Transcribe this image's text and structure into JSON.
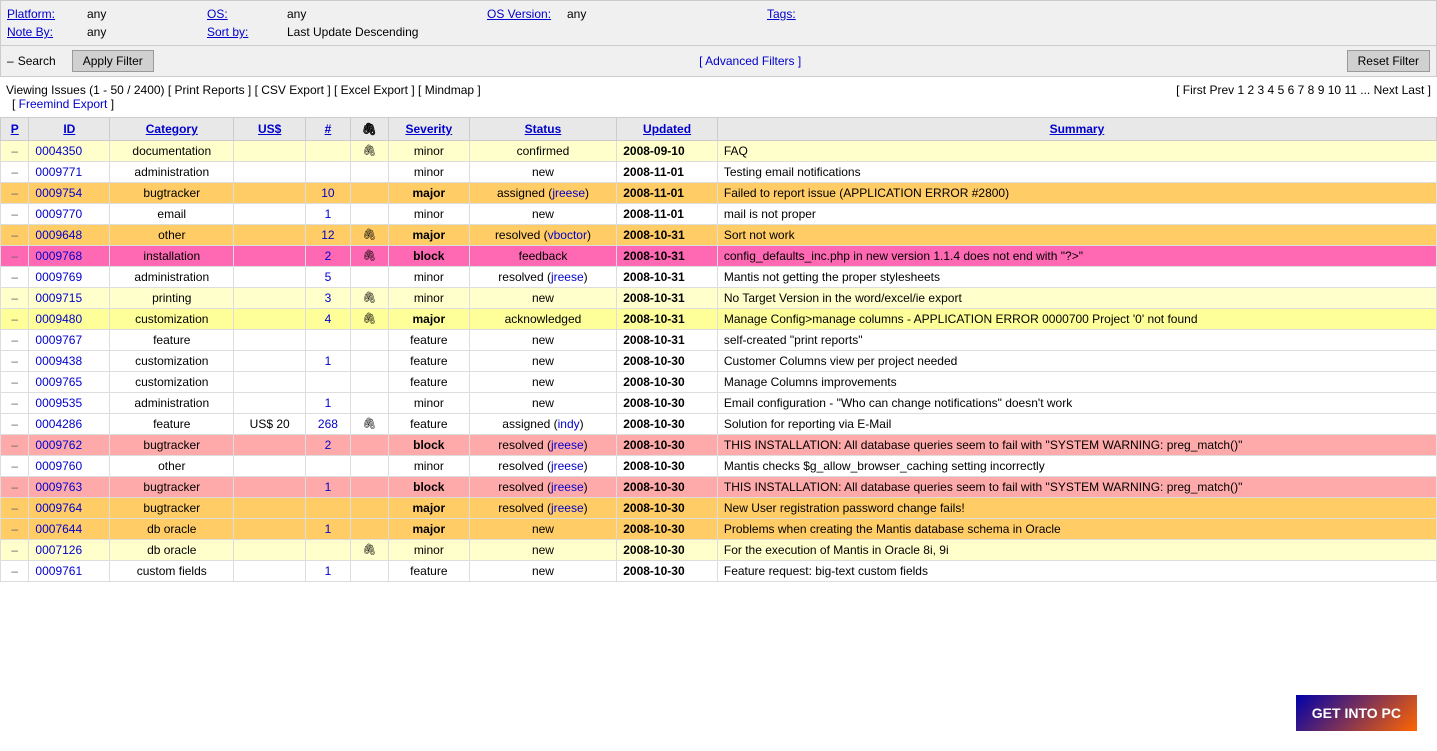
{
  "filter": {
    "labels": {
      "platform": "Platform:",
      "os": "OS:",
      "os_version": "OS Version:",
      "tags": "Tags:",
      "note_by": "Note By:",
      "sort_by": "Sort by:"
    },
    "values": {
      "platform": "any",
      "os": "any",
      "os_version": "any",
      "tags": "",
      "note_by": "any",
      "sort_by": "Last Update Descending"
    }
  },
  "search": {
    "label": "Search",
    "apply_label": "Apply Filter",
    "reset_label": "Reset Filter",
    "advanced_label": "[ Advanced Filters ]"
  },
  "issues": {
    "title": "Viewing Issues (1 - 50 / 2400)",
    "links": {
      "print": "Print Reports",
      "csv": "CSV Export",
      "excel": "Excel Export",
      "mindmap": "Mindmap",
      "freemind": "Freemind Export"
    },
    "pagination": {
      "text": "[ First Prev 1 2 3 4 5 6 7 8 9 10 11 ... Next Last ]",
      "first": "First",
      "prev": "Prev",
      "pages": [
        "1",
        "2",
        "3",
        "4",
        "5",
        "6",
        "7",
        "8",
        "9",
        "10",
        "11"
      ],
      "next": "Next",
      "last": "Last"
    }
  },
  "columns": {
    "p": "P",
    "id": "ID",
    "category": "Category",
    "us": "US$",
    "hash": "#",
    "clip": "🖇",
    "severity": "Severity",
    "status": "Status",
    "updated": "Updated",
    "summary": "Summary"
  },
  "rows": [
    {
      "rowClass": "row-light",
      "dash": "–",
      "id": "0004350",
      "category": "documentation",
      "us": "",
      "hash": "",
      "clip": "🖇",
      "severity": "minor",
      "severityBold": false,
      "status": "confirmed",
      "statusLink": true,
      "statusLinked": "",
      "updated": "2008-09-10",
      "summary": "FAQ"
    },
    {
      "rowClass": "row-white",
      "dash": "–",
      "id": "0009771",
      "category": "administration",
      "us": "",
      "hash": "",
      "clip": "",
      "severity": "minor",
      "severityBold": false,
      "status": "new",
      "statusLink": false,
      "statusLinked": "",
      "updated": "2008-11-01",
      "summary": "Testing email notifications"
    },
    {
      "rowClass": "row-orange",
      "dash": "–",
      "id": "0009754",
      "category": "bugtracker",
      "us": "",
      "hash": "10",
      "clip": "",
      "severity": "major",
      "severityBold": true,
      "status": "assigned",
      "statusLink": true,
      "statusLinked": "jreese",
      "updated": "2008-11-01",
      "summary": "Failed to report issue (APPLICATION ERROR #2800)"
    },
    {
      "rowClass": "row-white",
      "dash": "–",
      "id": "0009770",
      "category": "email",
      "us": "",
      "hash": "1",
      "clip": "",
      "severity": "minor",
      "severityBold": false,
      "status": "new",
      "statusLink": false,
      "statusLinked": "",
      "updated": "2008-11-01",
      "summary": "mail is not proper"
    },
    {
      "rowClass": "row-orange",
      "dash": "–",
      "id": "0009648",
      "category": "other",
      "us": "",
      "hash": "12",
      "clip": "🖇",
      "severity": "major",
      "severityBold": true,
      "status": "resolved",
      "statusLink": true,
      "statusLinked": "vboctor",
      "updated": "2008-10-31",
      "summary": "Sort not work"
    },
    {
      "rowClass": "row-hotpink",
      "dash": "–",
      "id": "0009768",
      "category": "installation",
      "us": "",
      "hash": "2",
      "clip": "🖇",
      "severity": "block",
      "severityBold": true,
      "status": "feedback",
      "statusLink": false,
      "statusLinked": "",
      "updated": "2008-10-31",
      "summary": "config_defaults_inc.php in new version 1.1.4 does not end with \"?>\""
    },
    {
      "rowClass": "row-white",
      "dash": "–",
      "id": "0009769",
      "category": "administration",
      "us": "",
      "hash": "5",
      "clip": "",
      "severity": "minor",
      "severityBold": false,
      "status": "resolved",
      "statusLink": true,
      "statusLinked": "jreese",
      "updated": "2008-10-31",
      "summary": "Mantis not getting the proper stylesheets"
    },
    {
      "rowClass": "row-light",
      "dash": "–",
      "id": "0009715",
      "category": "printing",
      "us": "",
      "hash": "3",
      "clip": "🖇",
      "severity": "minor",
      "severityBold": false,
      "status": "new",
      "statusLink": false,
      "statusLinked": "",
      "updated": "2008-10-31",
      "summary": "No Target Version in the word/excel/ie export"
    },
    {
      "rowClass": "row-yellow",
      "dash": "–",
      "id": "0009480",
      "category": "customization",
      "us": "",
      "hash": "4",
      "clip": "🖇",
      "severity": "major",
      "severityBold": true,
      "status": "acknowledged",
      "statusLink": false,
      "statusLinked": "",
      "updated": "2008-10-31",
      "summary": "Manage Config>manage columns - APPLICATION ERROR 0000700 Project '0' not found"
    },
    {
      "rowClass": "row-white",
      "dash": "–",
      "id": "0009767",
      "category": "feature",
      "us": "",
      "hash": "",
      "clip": "",
      "severity": "feature",
      "severityBold": false,
      "status": "new",
      "statusLink": false,
      "statusLinked": "",
      "updated": "2008-10-31",
      "summary": "self-created \"print reports\""
    },
    {
      "rowClass": "row-white",
      "dash": "–",
      "id": "0009438",
      "category": "customization",
      "us": "",
      "hash": "1",
      "clip": "",
      "severity": "feature",
      "severityBold": false,
      "status": "new",
      "statusLink": false,
      "statusLinked": "",
      "updated": "2008-10-30",
      "summary": "Customer Columns view per project needed"
    },
    {
      "rowClass": "row-white",
      "dash": "–",
      "id": "0009765",
      "category": "customization",
      "us": "",
      "hash": "",
      "clip": "",
      "severity": "feature",
      "severityBold": false,
      "status": "new",
      "statusLink": false,
      "statusLinked": "",
      "updated": "2008-10-30",
      "summary": "Manage Columns improvements"
    },
    {
      "rowClass": "row-white",
      "dash": "–",
      "id": "0009535",
      "category": "administration",
      "us": "",
      "hash": "1",
      "clip": "",
      "severity": "minor",
      "severityBold": false,
      "status": "new",
      "statusLink": false,
      "statusLinked": "",
      "updated": "2008-10-30",
      "summary": "Email configuration - \"Who can change notifications\" doesn't work"
    },
    {
      "rowClass": "row-white",
      "dash": "–",
      "id": "0004286",
      "category": "feature",
      "us": "US$ 20",
      "hash": "268",
      "clip": "🖇",
      "severity": "feature",
      "severityBold": false,
      "status": "assigned",
      "statusLink": true,
      "statusLinked": "indy",
      "updated": "2008-10-30",
      "summary": "Solution for reporting via E-Mail"
    },
    {
      "rowClass": "row-pink",
      "dash": "–",
      "id": "0009762",
      "category": "bugtracker",
      "us": "",
      "hash": "2",
      "clip": "",
      "severity": "block",
      "severityBold": true,
      "status": "resolved",
      "statusLink": true,
      "statusLinked": "jreese",
      "updated": "2008-10-30",
      "summary": "THIS INSTALLATION: All database queries seem to fail with \"SYSTEM WARNING: preg_match()\""
    },
    {
      "rowClass": "row-white",
      "dash": "–",
      "id": "0009760",
      "category": "other",
      "us": "",
      "hash": "",
      "clip": "",
      "severity": "minor",
      "severityBold": false,
      "status": "resolved",
      "statusLink": true,
      "statusLinked": "jreese",
      "updated": "2008-10-30",
      "summary": "Mantis checks $g_allow_browser_caching setting incorrectly"
    },
    {
      "rowClass": "row-pink",
      "dash": "–",
      "id": "0009763",
      "category": "bugtracker",
      "us": "",
      "hash": "1",
      "clip": "",
      "severity": "block",
      "severityBold": true,
      "status": "resolved",
      "statusLink": true,
      "statusLinked": "jreese",
      "updated": "2008-10-30",
      "summary": "THIS INSTALLATION: All database queries seem to fail with \"SYSTEM WARNING: preg_match()\""
    },
    {
      "rowClass": "row-orange",
      "dash": "–",
      "id": "0009764",
      "category": "bugtracker",
      "us": "",
      "hash": "",
      "clip": "",
      "severity": "major",
      "severityBold": true,
      "status": "resolved",
      "statusLink": true,
      "statusLinked": "jreese",
      "updated": "2008-10-30",
      "summary": "New User registration password change fails!"
    },
    {
      "rowClass": "row-orange",
      "dash": "–",
      "id": "0007644",
      "category": "db oracle",
      "us": "",
      "hash": "1",
      "clip": "",
      "severity": "major",
      "severityBold": true,
      "status": "new",
      "statusLink": false,
      "statusLinked": "",
      "updated": "2008-10-30",
      "summary": "Problems when creating the Mantis database schema in Oracle"
    },
    {
      "rowClass": "row-light",
      "dash": "–",
      "id": "0007126",
      "category": "db oracle",
      "us": "",
      "hash": "",
      "clip": "🖇",
      "severity": "minor",
      "severityBold": false,
      "status": "new",
      "statusLink": false,
      "statusLinked": "",
      "updated": "2008-10-30",
      "summary": "For the execution of Mantis in Oracle 8i, 9i"
    },
    {
      "rowClass": "row-white",
      "dash": "–",
      "id": "0009761",
      "category": "custom fields",
      "us": "",
      "hash": "1",
      "clip": "",
      "severity": "feature",
      "severityBold": false,
      "status": "new",
      "statusLink": false,
      "statusLinked": "",
      "updated": "2008-10-30",
      "summary": "Feature request: big-text custom fields"
    }
  ]
}
